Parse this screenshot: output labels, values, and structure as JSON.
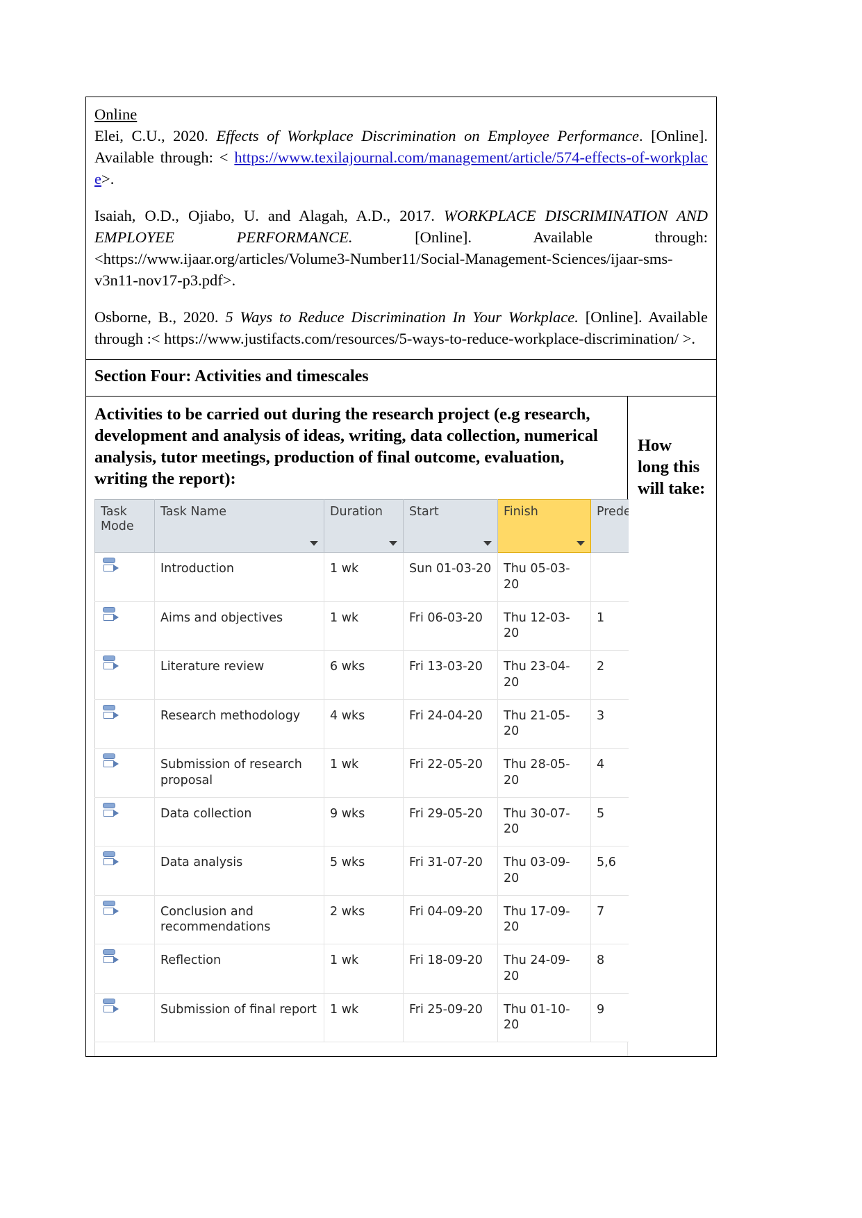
{
  "references": {
    "section_label": "Online",
    "entries": [
      {
        "id": "elei",
        "segments": [
          {
            "text": "Elei, C.U., 2020. ",
            "style": "normal"
          },
          {
            "text": "Effects of Workplace Discrimination on Employee Performance",
            "style": "italic"
          },
          {
            "text": ". [Online]. Available through: < ",
            "style": "normal"
          },
          {
            "text": "https://www.texilajournal.com/management/article/574-effects-of-workplace",
            "style": "link"
          },
          {
            "text": ">.",
            "style": "normal"
          }
        ]
      },
      {
        "id": "isaiah",
        "segments": [
          {
            "text": "Isaiah, O.D., Ojiabo, U. and Alagah, A.D., 2017. ",
            "style": "normal"
          },
          {
            "text": "WORKPLACE DISCRIMINATION AND EMPLOYEE PERFORMANCE.",
            "style": "italic"
          },
          {
            "text": " [Online]. Available through: <https://www.ijaar.org/articles/Volume3-Number11/Social-Management-Sciences/ijaar-sms-v3n11-nov17-p3.pdf>.",
            "style": "normal"
          }
        ]
      },
      {
        "id": "osborne",
        "segments": [
          {
            "text": "Osborne, B., 2020. ",
            "style": "normal"
          },
          {
            "text": "5 Ways to Reduce Discrimination In Your Workplace.",
            "style": "italic"
          },
          {
            "text": " [Online]. Available through :< https://www.justifacts.com/resources/5-ways-to-reduce-workplace-discrimination/ >.",
            "style": "normal"
          }
        ]
      }
    ]
  },
  "section_four": {
    "heading": "Section Four: Activities and timescales"
  },
  "activities": {
    "heading": "Activities to be carried out during the research project (e.g research, development and analysis of ideas, writing, data collection, numerical analysis, tutor meetings, production of final outcome, evaluation, writing the report):",
    "how_long_heading": "How long this will take:"
  },
  "gantt": {
    "columns": [
      {
        "key": "task_mode",
        "label": "Task Mode",
        "highlighted": false
      },
      {
        "key": "task_name",
        "label": "Task Name",
        "highlighted": false
      },
      {
        "key": "duration",
        "label": "Duration",
        "highlighted": false
      },
      {
        "key": "start",
        "label": "Start",
        "highlighted": false
      },
      {
        "key": "finish",
        "label": "Finish",
        "highlighted": true
      },
      {
        "key": "predecessors",
        "label": "Predec",
        "highlighted": false
      }
    ],
    "highlight_color": "#ffd966",
    "header_color": "#dde3e9",
    "mode_icon": "manually-scheduled-task-icon",
    "rows": [
      {
        "mode_icon": "manually-scheduled-task-icon",
        "task_name": "Introduction",
        "duration": "1 wk",
        "start": "Sun 01-03-20",
        "finish": "Thu 05-03-20",
        "predecessors": ""
      },
      {
        "mode_icon": "manually-scheduled-task-icon",
        "task_name": "Aims and objectives",
        "duration": "1 wk",
        "start": "Fri 06-03-20",
        "finish": "Thu 12-03-20",
        "predecessors": "1"
      },
      {
        "mode_icon": "manually-scheduled-task-icon",
        "task_name": "Literature review",
        "duration": "6 wks",
        "start": "Fri 13-03-20",
        "finish": "Thu 23-04-20",
        "predecessors": "2"
      },
      {
        "mode_icon": "manually-scheduled-task-icon",
        "task_name": "Research methodology",
        "duration": "4 wks",
        "start": "Fri 24-04-20",
        "finish": "Thu 21-05-20",
        "predecessors": "3"
      },
      {
        "mode_icon": "manually-scheduled-task-icon",
        "task_name": "Submission of research proposal",
        "duration": "1 wk",
        "start": "Fri 22-05-20",
        "finish": "Thu 28-05-20",
        "predecessors": "4"
      },
      {
        "mode_icon": "manually-scheduled-task-icon",
        "task_name": "Data collection",
        "duration": "9 wks",
        "start": "Fri 29-05-20",
        "finish": "Thu 30-07-20",
        "predecessors": "5"
      },
      {
        "mode_icon": "manually-scheduled-task-icon",
        "task_name": "Data analysis",
        "duration": "5 wks",
        "start": "Fri 31-07-20",
        "finish": "Thu 03-09-20",
        "predecessors": "5,6"
      },
      {
        "mode_icon": "manually-scheduled-task-icon",
        "task_name": "Conclusion and recommendations",
        "duration": "2 wks",
        "start": "Fri 04-09-20",
        "finish": "Thu 17-09-20",
        "predecessors": "7"
      },
      {
        "mode_icon": "manually-scheduled-task-icon",
        "task_name": "Reflection",
        "duration": "1 wk",
        "start": "Fri 18-09-20",
        "finish": "Thu 24-09-20",
        "predecessors": "8"
      },
      {
        "mode_icon": "manually-scheduled-task-icon",
        "task_name": "Submission of final report",
        "duration": "1 wk",
        "start": "Fri 25-09-20",
        "finish": "Thu 01-10-20",
        "predecessors": "9"
      }
    ]
  }
}
